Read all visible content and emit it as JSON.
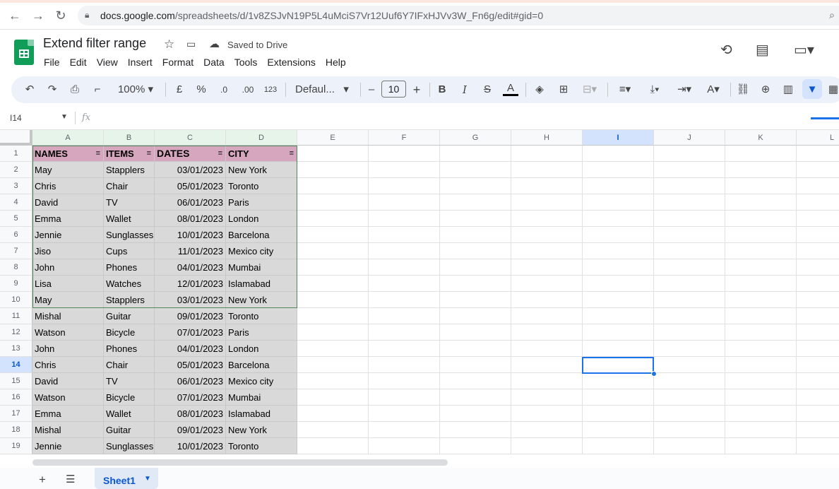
{
  "browser": {
    "url_domain": "docs.google.com",
    "url_path": "/spreadsheets/d/1v8ZSJvN19P5L4uMciS7Vr12Uuf6Y7IFxHJVv3W_Fn6g/edit#gid=0",
    "back_icon": "arrow-left",
    "forward_icon": "arrow-right",
    "reload_icon": "reload",
    "lock_icon": "lock",
    "zoom_icon": "magnifier"
  },
  "doc": {
    "title": "Extend filter range",
    "saved_status": "Saved to Drive",
    "menu": [
      "File",
      "Edit",
      "View",
      "Insert",
      "Format",
      "Data",
      "Tools",
      "Extensions",
      "Help"
    ]
  },
  "toolbar": {
    "zoom": "100%",
    "currency": "£",
    "percent": "%",
    "dec_decrease": ".0",
    "dec_increase": ".00",
    "more_formats": "123",
    "font": "Defaul...",
    "font_size": "10",
    "bold": "B",
    "italic": "I",
    "strike": "S",
    "text_color": "A",
    "minus": "–",
    "plus": "+"
  },
  "formula_bar": {
    "name_box": "I14",
    "fx": "fx"
  },
  "columns": [
    "A",
    "B",
    "C",
    "D",
    "E",
    "F",
    "G",
    "H",
    "I",
    "J",
    "K",
    "L"
  ],
  "selected_column": "I",
  "selected_row": "14",
  "header_row": [
    "NAMES",
    "ITEMS",
    "DATES",
    "CITY"
  ],
  "rows": [
    [
      "May",
      "Stapplers",
      "03/01/2023",
      "New York"
    ],
    [
      "Chris",
      "Chair",
      "05/01/2023",
      "Toronto"
    ],
    [
      "David",
      "TV",
      "06/01/2023",
      "Paris"
    ],
    [
      "Emma",
      "Wallet",
      "08/01/2023",
      "London"
    ],
    [
      "Jennie",
      "Sunglasses",
      "10/01/2023",
      "Barcelona"
    ],
    [
      "Jiso",
      "Cups",
      "11/01/2023",
      "Mexico city"
    ],
    [
      "John",
      "Phones",
      "04/01/2023",
      "Mumbai"
    ],
    [
      "Lisa",
      "Watches",
      "12/01/2023",
      "Islamabad"
    ],
    [
      "May",
      "Stapplers",
      "03/01/2023",
      "New York"
    ],
    [
      "Mishal",
      "Guitar",
      "09/01/2023",
      "Toronto"
    ],
    [
      "Watson",
      "Bicycle",
      "07/01/2023",
      "Paris"
    ],
    [
      "John",
      "Phones",
      "04/01/2023",
      "London"
    ],
    [
      "Chris",
      "Chair",
      "05/01/2023",
      "Barcelona"
    ],
    [
      "David",
      "TV",
      "06/01/2023",
      "Mexico city"
    ],
    [
      "Watson",
      "Bicycle",
      "07/01/2023",
      "Mumbai"
    ],
    [
      "Emma",
      "Wallet",
      "08/01/2023",
      "Islamabad"
    ],
    [
      "Mishal",
      "Guitar",
      "09/01/2023",
      "New York"
    ],
    [
      "Jennie",
      "Sunglasses",
      "10/01/2023",
      "Toronto"
    ]
  ],
  "row_numbers": [
    "1",
    "2",
    "3",
    "4",
    "5",
    "6",
    "7",
    "8",
    "9",
    "10",
    "11",
    "12",
    "13",
    "14",
    "15",
    "16",
    "17",
    "18",
    "19"
  ],
  "sheets": [
    {
      "label": "Sheet1",
      "active": true
    }
  ],
  "colors": {
    "header_fill": "#d5a6bd",
    "data_fill": "#d9d9d9",
    "selection": "#1a73e8",
    "brand_green": "#0f9d58"
  }
}
